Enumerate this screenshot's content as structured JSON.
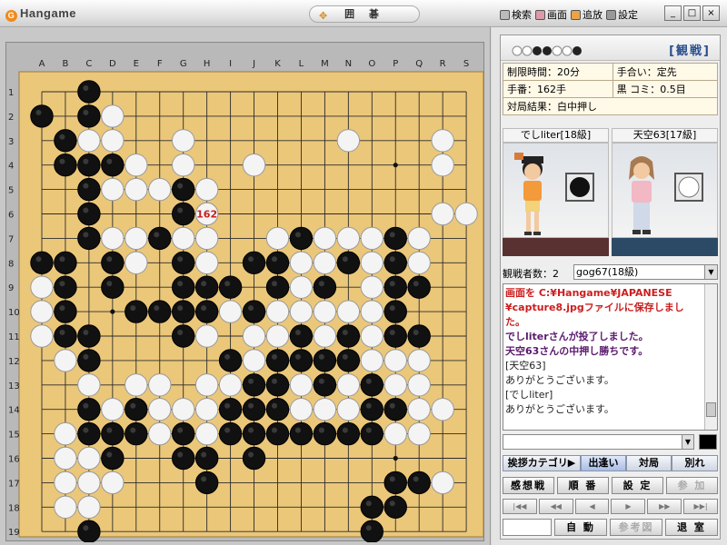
{
  "window": {
    "logo": "Hangame",
    "title": "囲 碁",
    "menu": [
      {
        "label": "検索",
        "icon": "search-icon"
      },
      {
        "label": "画面",
        "icon": "screen-icon"
      },
      {
        "label": "追放",
        "icon": "kick-icon"
      },
      {
        "label": "設定",
        "icon": "settings-icon"
      }
    ],
    "controls": [
      "_",
      "□",
      "×"
    ]
  },
  "board": {
    "size": 19,
    "col_labels": [
      "A",
      "B",
      "C",
      "D",
      "E",
      "F",
      "G",
      "H",
      "I",
      "J",
      "K",
      "L",
      "M",
      "N",
      "O",
      "P",
      "Q",
      "R",
      "S"
    ],
    "row_labels": [
      "1",
      "2",
      "3",
      "4",
      "5",
      "6",
      "7",
      "8",
      "9",
      "10",
      "11",
      "12",
      "13",
      "14",
      "15",
      "16",
      "17",
      "18",
      "19"
    ],
    "rows": [
      "..B................",
      "B.BW...............",
      ".BWW..W......W...W.",
      ".BBBW.W..W.......W.",
      "..BWWWBW...........",
      "..B...BW.........WW",
      "..BWWBWW..WBWWWBW..",
      "BB.BW.BW.BBWWBWBW..",
      "WB.B..BBB.BWB.WBB..",
      "WB..BBBBWBWWWWWB...",
      "WBB...BW.WWBWBWBB..",
      ".WB.....BWBBBBWWW..",
      "..W.WW.WWBBWBWBWW..",
      "..BWBWWWBBBWWWBBWW.",
      ".WBBBWBWBBBBBBBWW..",
      ".WWB..BB.B.........",
      ".WWW...B.......BBW.",
      ".WW...........BB...",
      "..B...........B....",
      "..................."
    ],
    "last_move": {
      "col": 8,
      "row": 6,
      "label": "162"
    },
    "colors": {
      "board": "#ebc77a",
      "line": "#2c2c2c",
      "last_move_label": "#cc1e1e"
    }
  },
  "side": {
    "mode_label": "[観戦]",
    "info": {
      "time_limit": "制限時間：20分",
      "handicap": "手合い：定先",
      "move_count": "手番：162手",
      "komi": "黒 コミ：0.5目",
      "result": "対局結果：白中押し"
    },
    "players": [
      {
        "name": "でしliter[18級]",
        "stone": "black",
        "color_bar": "#5a3131"
      },
      {
        "name": "天空63[17級]",
        "stone": "white",
        "color_bar": "#2c4a66"
      }
    ],
    "watchers_label": "観戦者数：2",
    "watchers_selected": "gog67(18級)",
    "chat": [
      {
        "text": "画面を C:¥Hangame¥JAPANESE",
        "color": "#cc1e1e",
        "bold": true
      },
      {
        "text": "¥capture8.jpgファイルに保存しまし",
        "color": "#cc1e1e",
        "bold": true
      },
      {
        "text": "た。",
        "color": "#cc1e1e",
        "bold": true
      },
      {
        "text": "でしliterさんが投了しました。",
        "color": "#5b1a6e",
        "bold": true
      },
      {
        "text": "天空63さんの中押し勝ちです。",
        "color": "#5b1a6e",
        "bold": true
      },
      {
        "text": "[天空63]",
        "color": "#222222",
        "bold": false
      },
      {
        "text": "ありがとうございます。",
        "color": "#222222",
        "bold": false
      },
      {
        "text": "[でしliter]",
        "color": "#222222",
        "bold": false
      },
      {
        "text": "ありがとうございます。",
        "color": "#222222",
        "bold": false
      }
    ],
    "greet_bar": {
      "category": "挨拶カテゴリ▶",
      "buttons": [
        "出逢い",
        "対局",
        "別れ"
      ]
    },
    "buttons_row1": [
      "感想戦",
      "順 番",
      "設 定",
      "参 加"
    ],
    "nav_buttons": [
      "|◀◀",
      "◀◀",
      "◀",
      "▶",
      "▶▶",
      "▶▶|"
    ],
    "buttons_row3": [
      "自 動",
      "参考図",
      "退 室"
    ]
  }
}
